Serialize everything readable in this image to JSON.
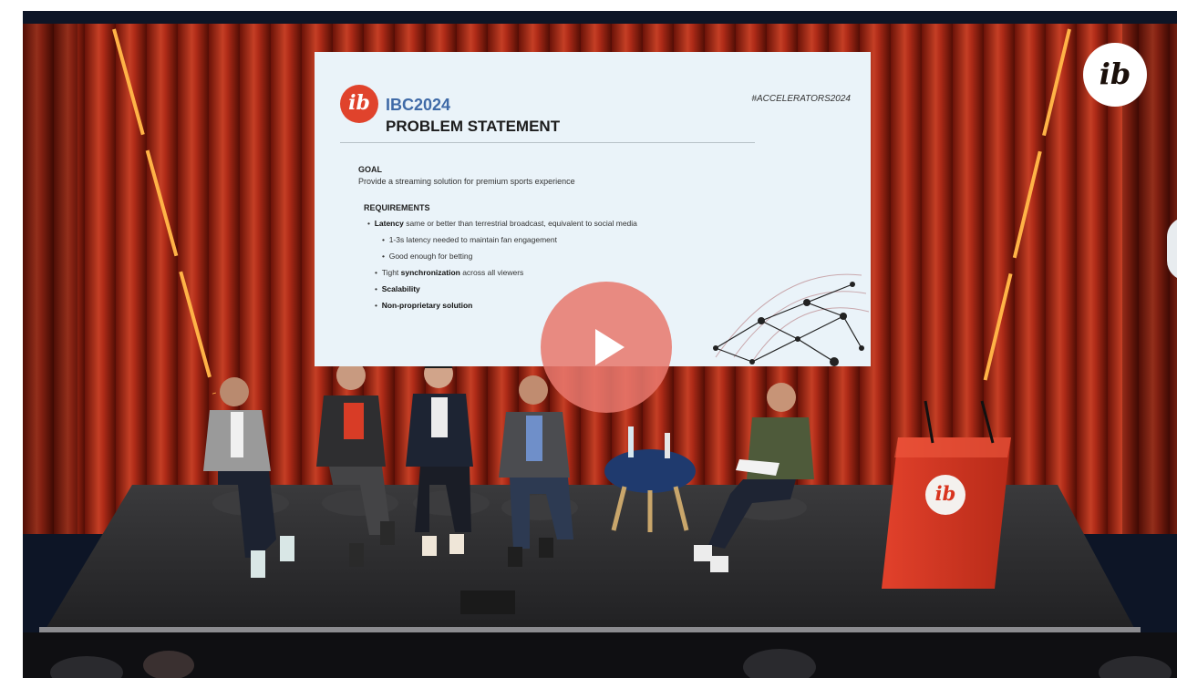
{
  "video": {
    "play_label": "Play video",
    "brand_mark": "ib",
    "podium_mark": "ib"
  },
  "slide": {
    "logo_mark": "ib",
    "event": "IBC2024",
    "title": "PROBLEM STATEMENT",
    "hashtag": "#ACCELERATORS2024",
    "goal_heading": "GOAL",
    "goal_text": "Provide a streaming solution for premium sports experience",
    "requirements_heading": "REQUIREMENTS",
    "bullets": [
      {
        "bold": "Latency",
        "text": " same or better than terrestrial broadcast, equivalent to social media"
      },
      {
        "bold": "",
        "text": "1-3s latency needed to maintain fan engagement"
      },
      {
        "bold": "",
        "text": "Good enough for betting"
      },
      {
        "bold": "synchronization",
        "prefix": "Tight ",
        "text": " across all viewers"
      },
      {
        "bold": "Scalability",
        "text": ""
      },
      {
        "bold": "Non-proprietary solution",
        "text": ""
      }
    ]
  },
  "colors": {
    "curtain": "#c8321c",
    "curtain_dark": "#6a1208",
    "neon": "#ffb347",
    "stage": "#2b2b2d",
    "podium": "#d8341f",
    "player_bg": "#0d1526",
    "play_button": "#e8786e"
  }
}
